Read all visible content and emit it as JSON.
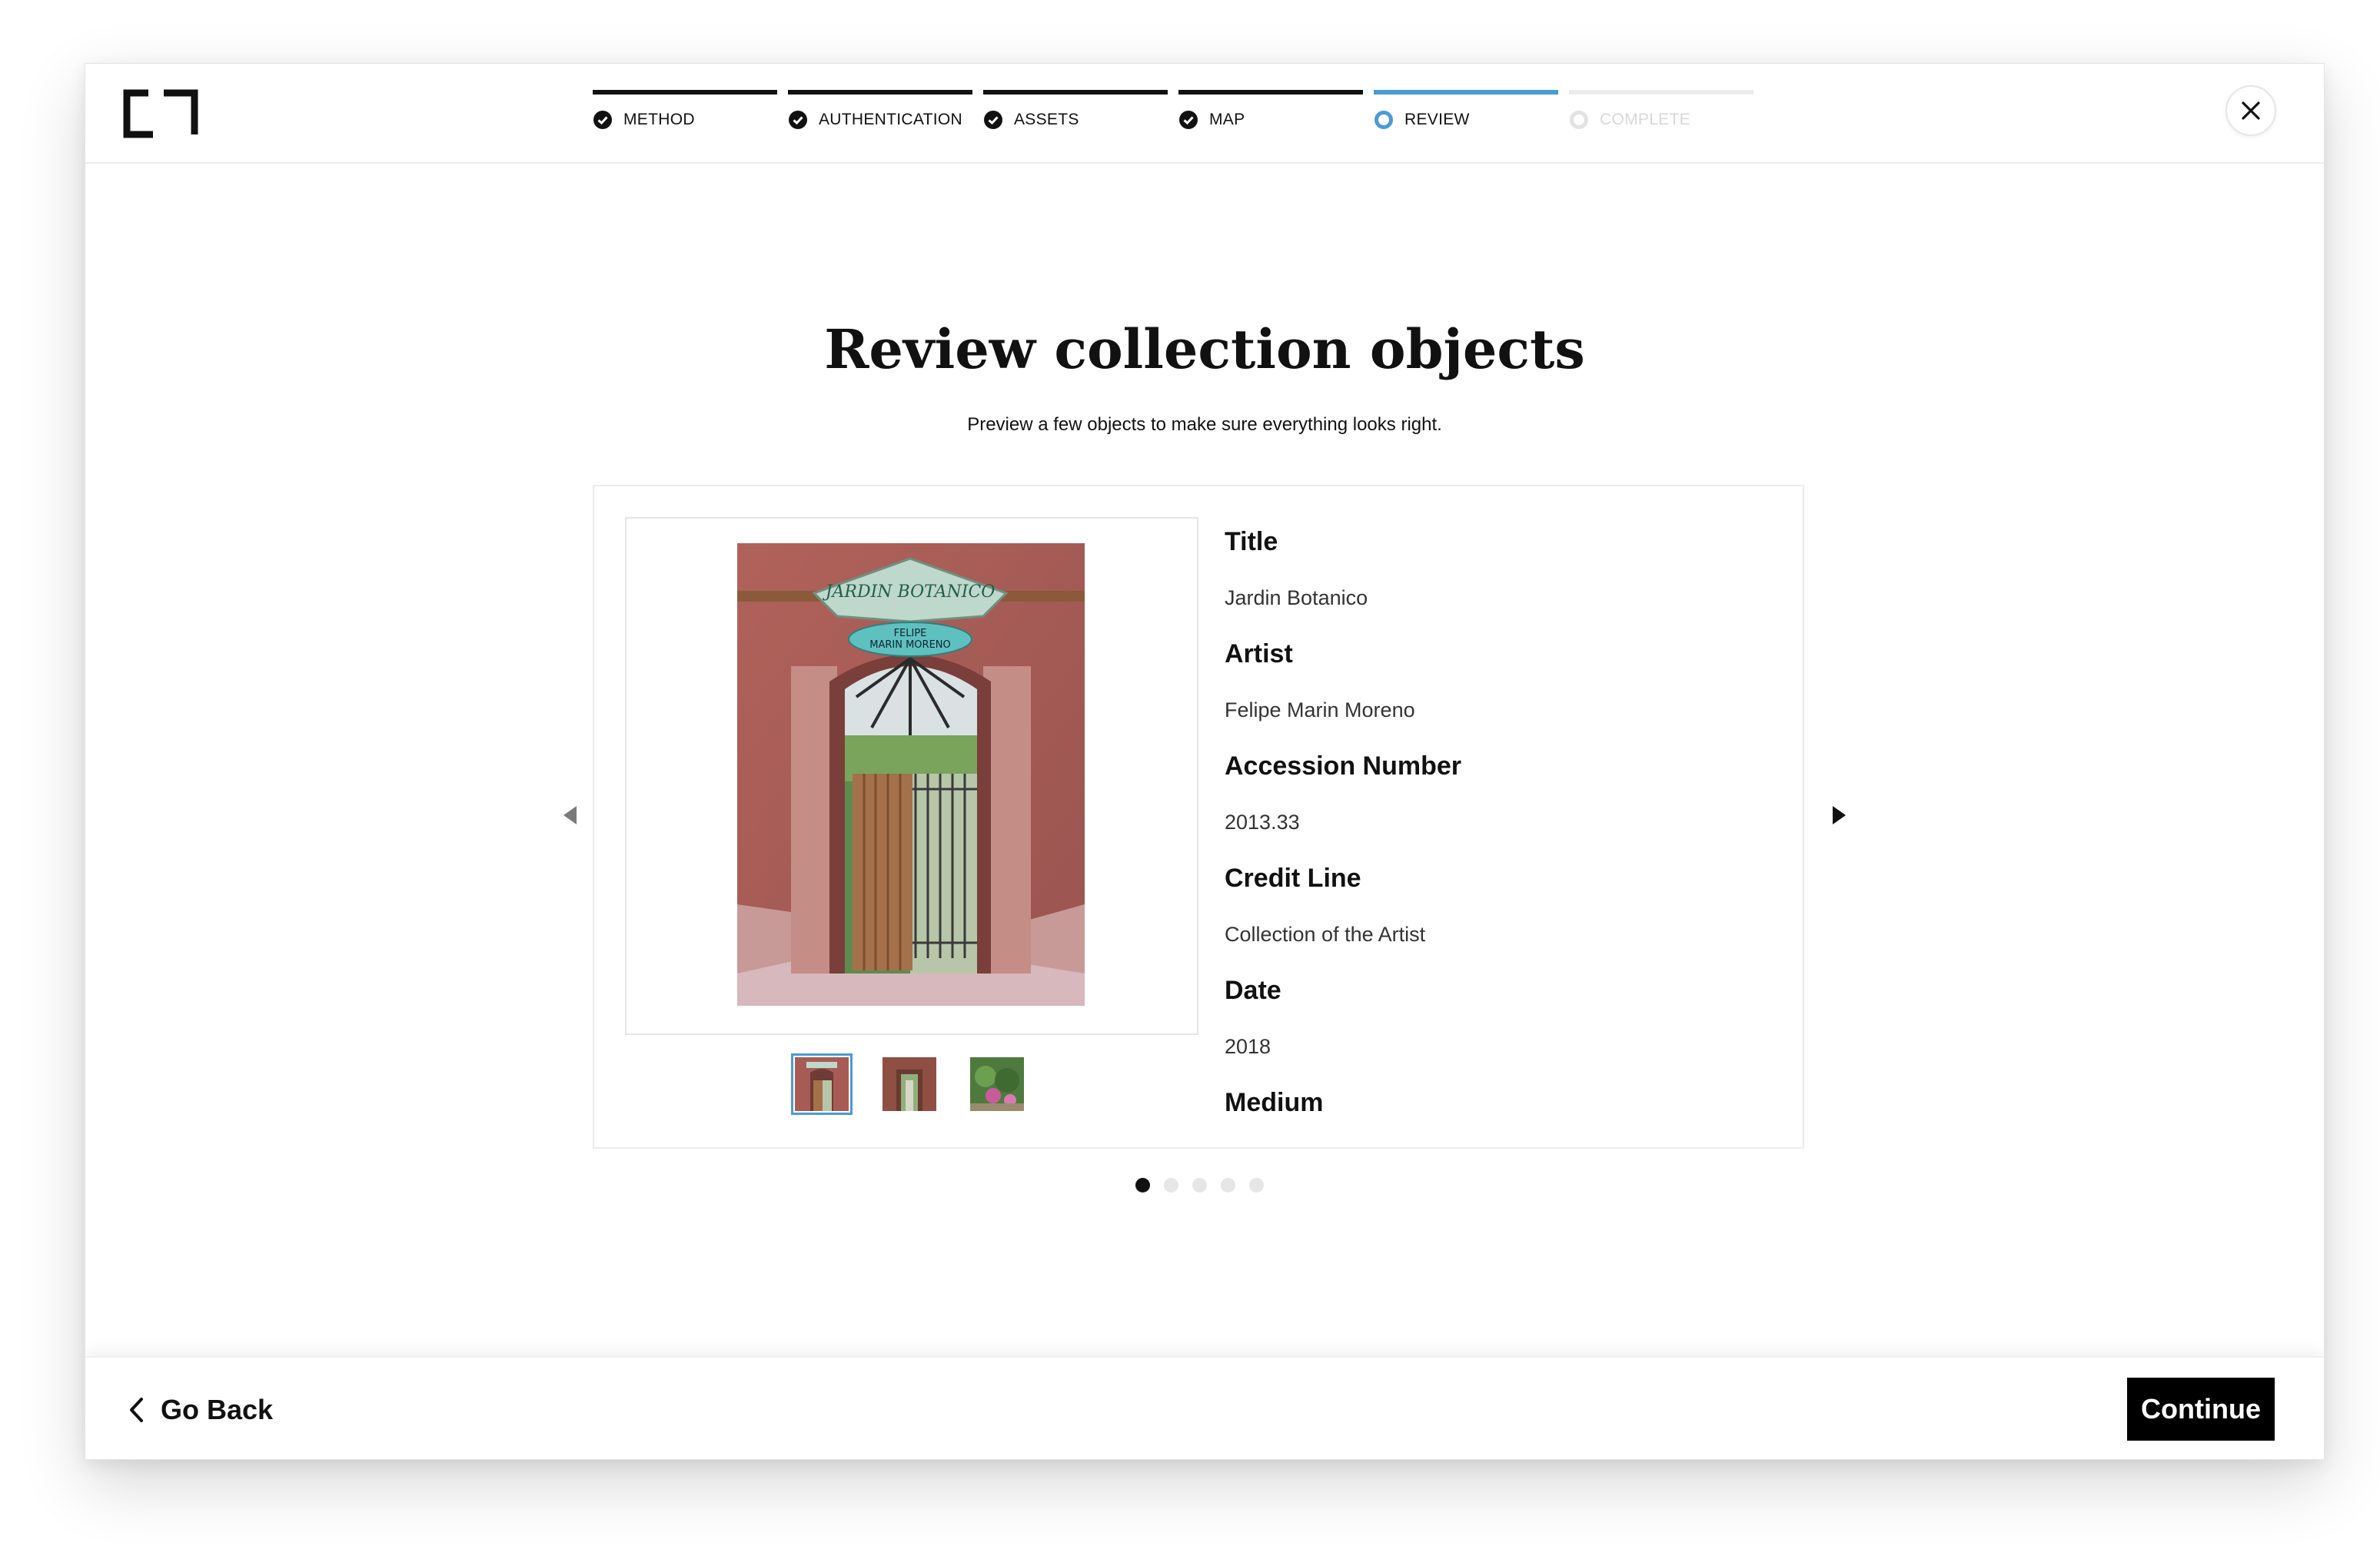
{
  "header": {
    "steps": [
      {
        "label": "METHOD",
        "status": "done"
      },
      {
        "label": "AUTHENTICATION",
        "status": "done"
      },
      {
        "label": "ASSETS",
        "status": "done"
      },
      {
        "label": "MAP",
        "status": "done"
      },
      {
        "label": "REVIEW",
        "status": "current"
      },
      {
        "label": "COMPLETE",
        "status": "todo"
      }
    ],
    "close_icon": "close-icon"
  },
  "main": {
    "title": "Review collection objects",
    "subtitle": "Preview a few objects to make sure everything looks right."
  },
  "preview": {
    "fields": [
      {
        "label": "Title",
        "value": "Jardin Botanico"
      },
      {
        "label": "Artist",
        "value": "Felipe Marin Moreno"
      },
      {
        "label": "Accession Number",
        "value": "2013.33"
      },
      {
        "label": "Credit Line",
        "value": "Collection of the Artist"
      },
      {
        "label": "Date",
        "value": "2018"
      },
      {
        "label": "Medium",
        "value": ""
      }
    ],
    "image_sign": {
      "line1": "JARDIN BOTANICO",
      "line2a": "FELIPE",
      "line2b": "MARIN MORENO"
    },
    "thumbnail_count": 3,
    "active_thumbnail": 1,
    "pager_total": 5,
    "pager_current": 1
  },
  "footer": {
    "back_label": "Go Back",
    "continue_label": "Continue"
  },
  "colors": {
    "accent": "#4a9bd6",
    "primary": "#000000",
    "inactive": "#e6e6e6"
  }
}
